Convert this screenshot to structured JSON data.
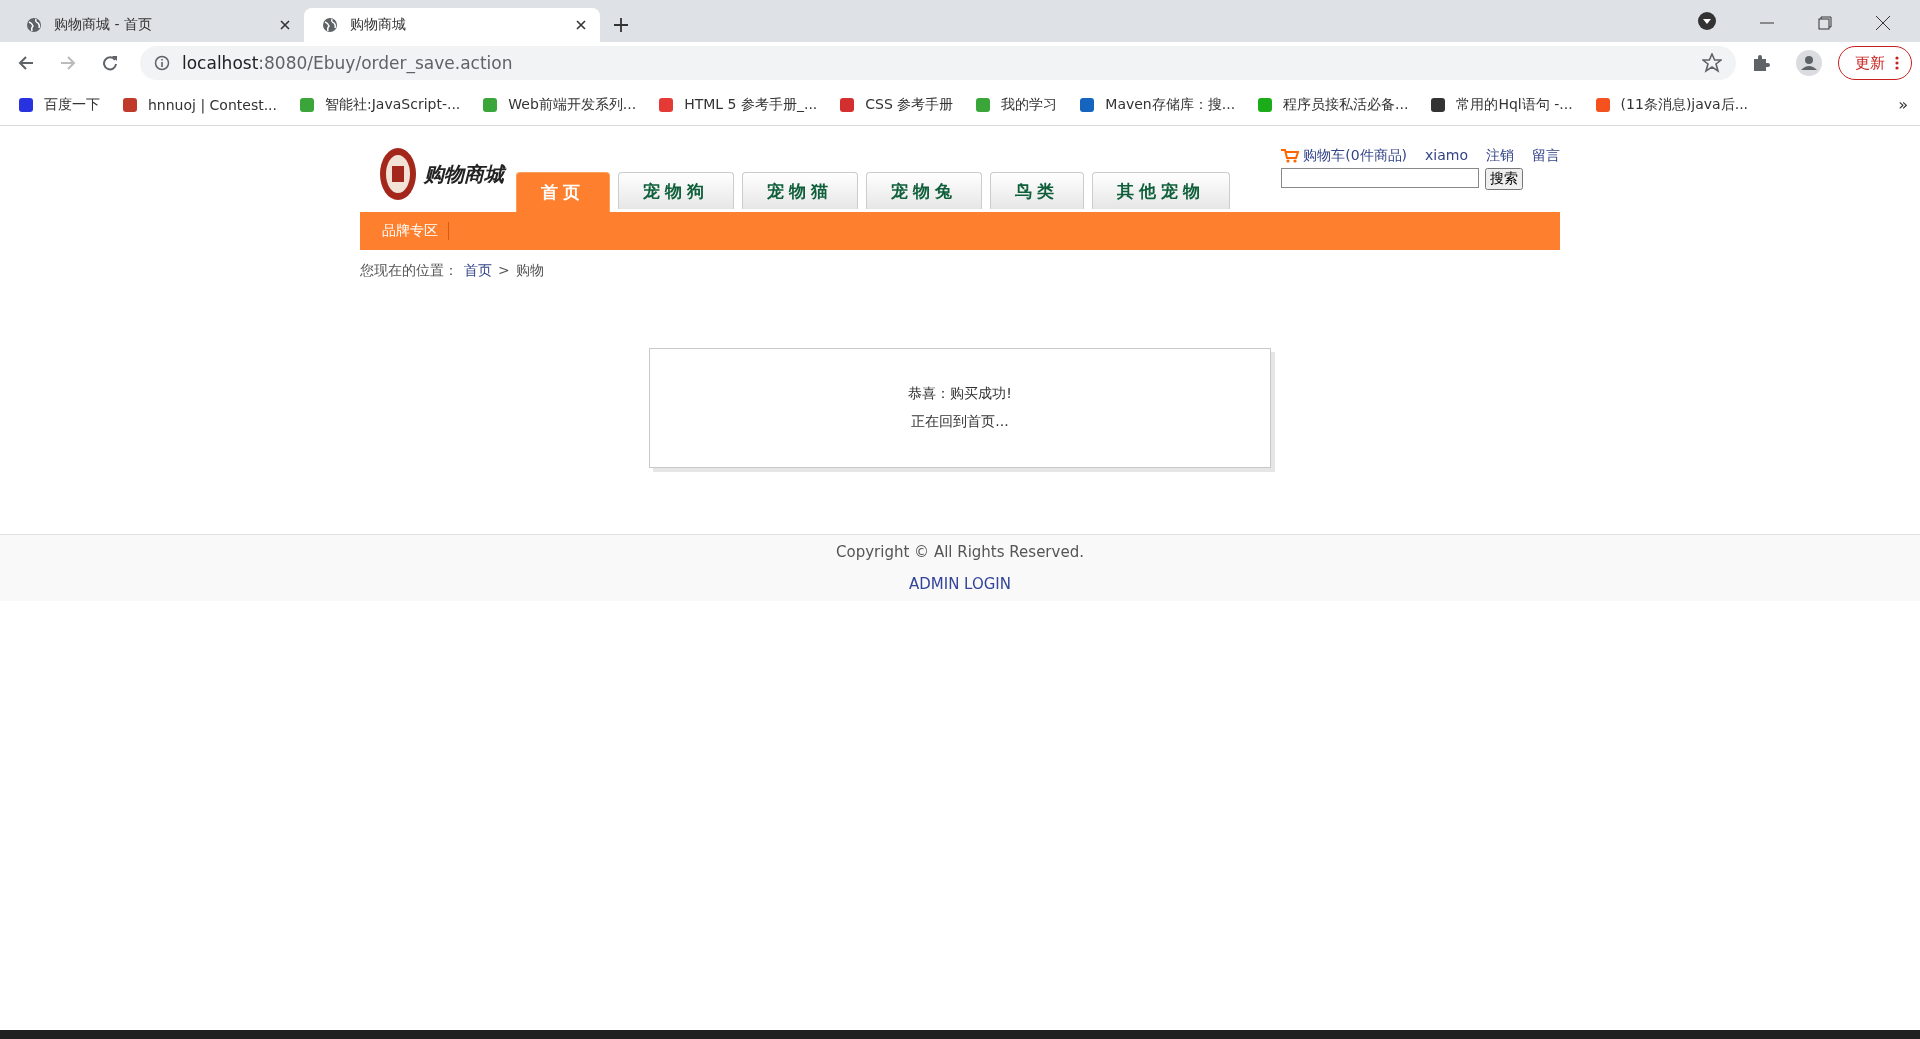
{
  "browser": {
    "tabs": [
      {
        "title": "购物商城 - 首页",
        "selected": false
      },
      {
        "title": "购物商城",
        "selected": true
      }
    ],
    "address": {
      "host": "localhost",
      "rest": ":8080/Ebuy/order_save.action"
    },
    "update_button": "更新",
    "bookmarks": [
      {
        "label": "百度一下",
        "color": "#2932e1"
      },
      {
        "label": "hnnuoj | Contest...",
        "color": "#c0392b"
      },
      {
        "label": "智能社:JavaScript-...",
        "color": "#3aa63a"
      },
      {
        "label": "Web前端开发系列...",
        "color": "#3aa63a"
      },
      {
        "label": "HTML 5 参考手册_...",
        "color": "#e53935"
      },
      {
        "label": "CSS 参考手册",
        "color": "#d32f2f"
      },
      {
        "label": "我的学习",
        "color": "#3aa63a"
      },
      {
        "label": "Maven存储库：搜...",
        "color": "#1565c0"
      },
      {
        "label": "程序员接私活必备...",
        "color": "#1aad19"
      },
      {
        "label": "常用的Hql语句 -...",
        "color": "#333333"
      },
      {
        "label": "(11条消息)java后...",
        "color": "#f4511e"
      }
    ],
    "more": "»"
  },
  "site": {
    "logo_text": "购物商城",
    "nav": [
      {
        "label": "首页",
        "selected": true
      },
      {
        "label": "宠物狗",
        "selected": false
      },
      {
        "label": "宠物猫",
        "selected": false
      },
      {
        "label": "宠物兔",
        "selected": false
      },
      {
        "label": "鸟类",
        "selected": false
      },
      {
        "label": "其他宠物",
        "selected": false
      }
    ],
    "top_links": {
      "cart": "购物车(0件商品)",
      "user": "xiamo",
      "logout": "注销",
      "message": "留言"
    },
    "search_button": "搜索",
    "sub_nav": [
      "品牌专区"
    ],
    "breadcrumb": {
      "label": "您现在的位置：",
      "home": "首页",
      "sep": ">",
      "current": "购物"
    },
    "message": [
      "恭喜：购买成功!",
      "正在回到首页..."
    ],
    "footer": {
      "copyright": "Copyright © All Rights Reserved.",
      "admin": "ADMIN LOGIN"
    }
  }
}
